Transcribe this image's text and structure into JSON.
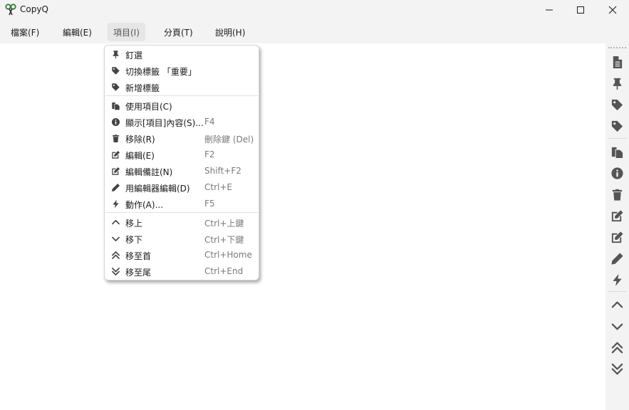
{
  "window": {
    "title": "CopyQ"
  },
  "menubar": {
    "items": [
      "檔案(F)",
      "編輯(E)",
      "項目(I)",
      "分頁(T)",
      "說明(H)"
    ]
  },
  "item_menu": {
    "pin": {
      "label": "釘選"
    },
    "toggle_tag": {
      "label": "切換標籤 「重要」"
    },
    "add_tag": {
      "label": "新增標籤"
    },
    "use_item": {
      "label": "使用項目(C)"
    },
    "show_content": {
      "label": "顯示[項目]內容(S)...",
      "shortcut": "F4"
    },
    "remove": {
      "label": "移除(R)",
      "shortcut": "刪除鍵 (Del)"
    },
    "edit": {
      "label": "編輯(E)",
      "shortcut": "F2"
    },
    "edit_notes": {
      "label": "編輯備註(N)",
      "shortcut": "Shift+F2"
    },
    "edit_with_editor": {
      "label": "用編輯器編輯(D)",
      "shortcut": "Ctrl+E"
    },
    "action": {
      "label": "動作(A)...",
      "shortcut": "F5"
    },
    "move_up": {
      "label": "移上",
      "shortcut": "Ctrl+上鍵"
    },
    "move_down": {
      "label": "移下",
      "shortcut": "Ctrl+下鍵"
    },
    "move_top": {
      "label": "移至首",
      "shortcut": "Ctrl+Home"
    },
    "move_bottom": {
      "label": "移至尾",
      "shortcut": "Ctrl+End"
    }
  },
  "toolbar": {
    "icons": [
      "new-item-icon",
      "pin-icon",
      "tag-icon",
      "tag-icon",
      "copy-icon",
      "info-icon",
      "trash-icon",
      "edit-icon",
      "edit-notes-icon",
      "pencil-icon",
      "bolt-icon",
      "chevron-up-icon",
      "chevron-down-icon",
      "double-chevron-up-icon",
      "double-chevron-down-icon"
    ]
  },
  "colors": {
    "icon": "#555555",
    "chrome": "#f3f3f3",
    "accent_green": "#3a9a4a"
  }
}
